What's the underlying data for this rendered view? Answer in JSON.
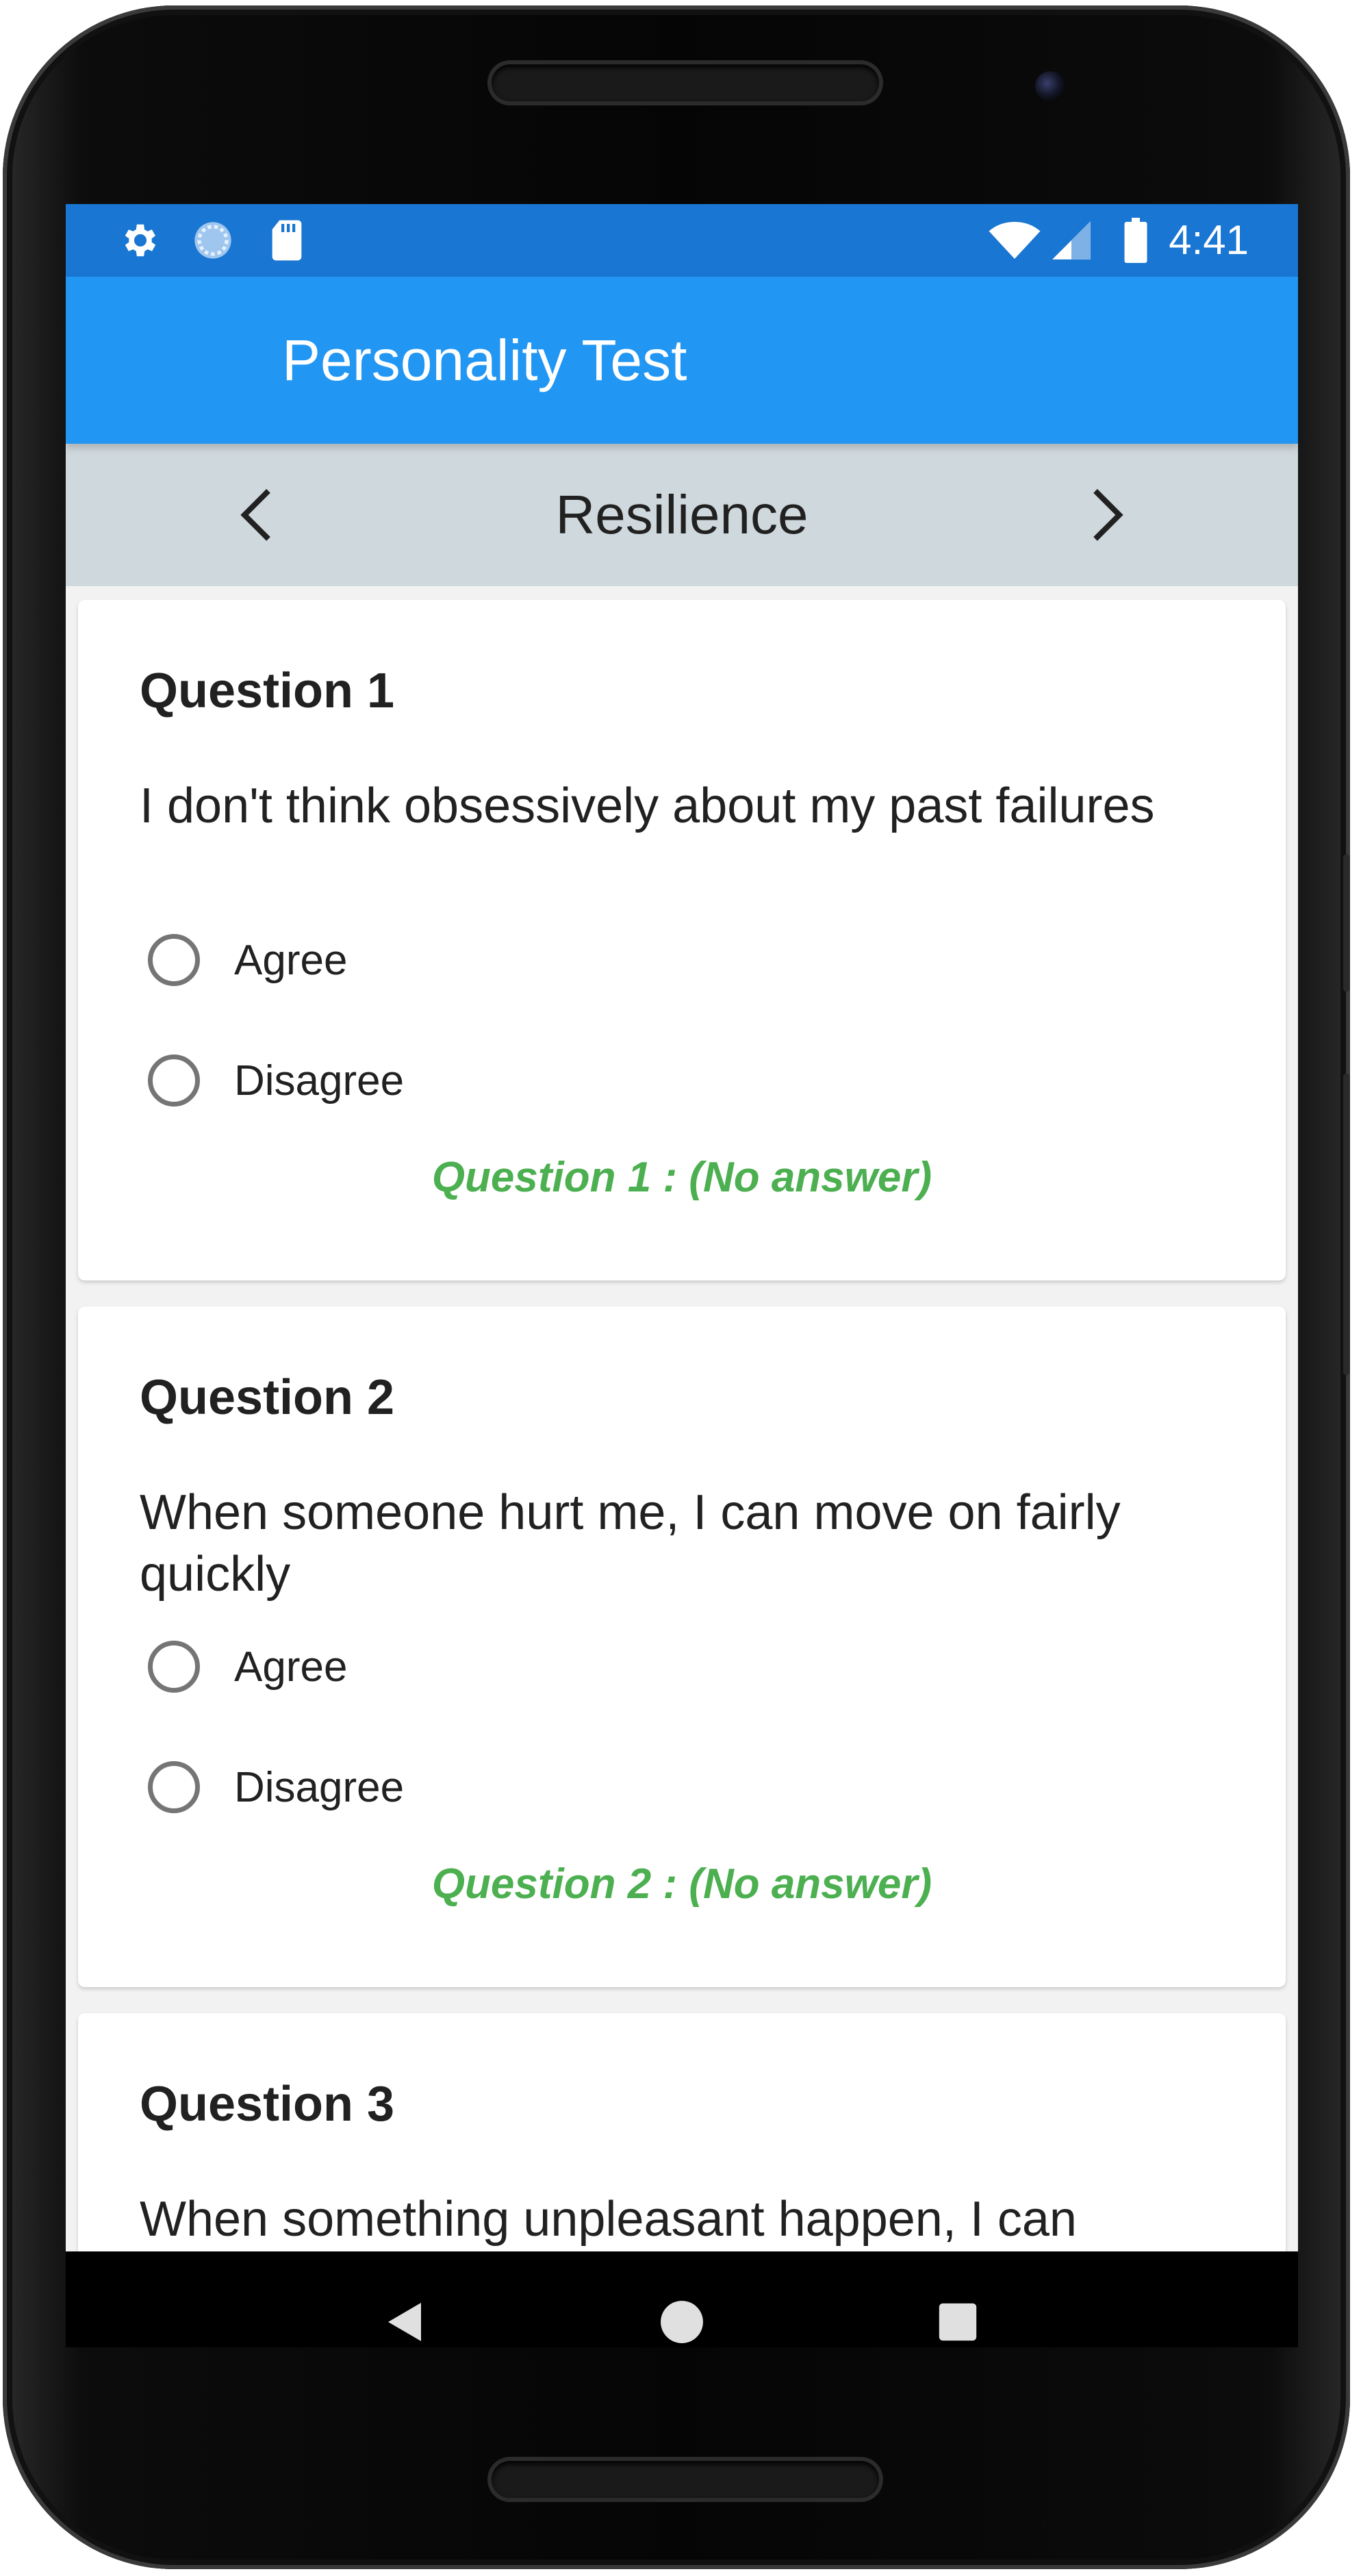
{
  "status_bar": {
    "time": "4:41",
    "icons": [
      "gear-icon",
      "sync-icon",
      "sd-card-icon",
      "wifi-icon",
      "signal-icon",
      "battery-icon"
    ]
  },
  "app_bar": {
    "title": "Personality Test",
    "background_color": "#2196F3",
    "status_color": "#1976D2"
  },
  "section_nav": {
    "title": "Resilience",
    "prev_icon": "chevron-left-icon",
    "next_icon": "chevron-right-icon",
    "background_color": "#CFD8DC"
  },
  "questions": [
    {
      "title": "Question 1",
      "text": "I don't think obsessively about my past failures",
      "options": [
        "Agree",
        "Disagree"
      ],
      "status": "Question 1 : (No answer)"
    },
    {
      "title": "Question 2",
      "text": "When someone hurt me, I can move on fairly quickly",
      "options": [
        "Agree",
        "Disagree"
      ],
      "status": "Question 2 : (No answer)"
    },
    {
      "title": "Question 3",
      "text": "When something unpleasant happen, I can"
    }
  ],
  "status_color": "#4CAF50",
  "system_nav": [
    "back-icon",
    "home-icon",
    "recents-icon"
  ]
}
